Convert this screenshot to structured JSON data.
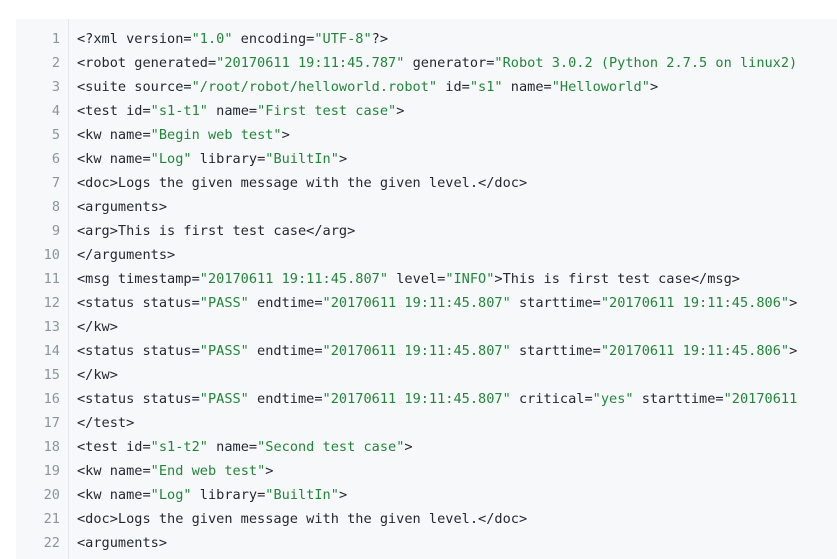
{
  "lines": [
    [
      {
        "t": "tag",
        "v": "<?xml version="
      },
      {
        "t": "str",
        "v": "\"1.0\""
      },
      {
        "t": "tag",
        "v": " encoding="
      },
      {
        "t": "str",
        "v": "\"UTF-8\""
      },
      {
        "t": "tag",
        "v": "?>"
      }
    ],
    [
      {
        "t": "tag",
        "v": "<robot generated="
      },
      {
        "t": "str",
        "v": "\"20170611 19:11:45.787\""
      },
      {
        "t": "tag",
        "v": " generator="
      },
      {
        "t": "str",
        "v": "\"Robot 3.0.2 (Python 2.7.5 on linux2)"
      }
    ],
    [
      {
        "t": "tag",
        "v": "<suite source="
      },
      {
        "t": "str",
        "v": "\"/root/robot/helloworld.robot\""
      },
      {
        "t": "tag",
        "v": " id="
      },
      {
        "t": "str",
        "v": "\"s1\""
      },
      {
        "t": "tag",
        "v": " name="
      },
      {
        "t": "str",
        "v": "\"Helloworld\""
      },
      {
        "t": "tag",
        "v": ">"
      }
    ],
    [
      {
        "t": "tag",
        "v": "<test id="
      },
      {
        "t": "str",
        "v": "\"s1-t1\""
      },
      {
        "t": "tag",
        "v": " name="
      },
      {
        "t": "str",
        "v": "\"First test case\""
      },
      {
        "t": "tag",
        "v": ">"
      }
    ],
    [
      {
        "t": "tag",
        "v": "<kw name="
      },
      {
        "t": "str",
        "v": "\"Begin web test\""
      },
      {
        "t": "tag",
        "v": ">"
      }
    ],
    [
      {
        "t": "tag",
        "v": "<kw name="
      },
      {
        "t": "str",
        "v": "\"Log\""
      },
      {
        "t": "tag",
        "v": " library="
      },
      {
        "t": "str",
        "v": "\"BuiltIn\""
      },
      {
        "t": "tag",
        "v": ">"
      }
    ],
    [
      {
        "t": "tag",
        "v": "<doc>"
      },
      {
        "t": "txt",
        "v": "Logs the given message with the given level."
      },
      {
        "t": "tag",
        "v": "</doc>"
      }
    ],
    [
      {
        "t": "tag",
        "v": "<arguments>"
      }
    ],
    [
      {
        "t": "tag",
        "v": "<arg>"
      },
      {
        "t": "txt",
        "v": "This is first test case"
      },
      {
        "t": "tag",
        "v": "</arg>"
      }
    ],
    [
      {
        "t": "tag",
        "v": "</arguments>"
      }
    ],
    [
      {
        "t": "tag",
        "v": "<msg timestamp="
      },
      {
        "t": "str",
        "v": "\"20170611 19:11:45.807\""
      },
      {
        "t": "tag",
        "v": " level="
      },
      {
        "t": "str",
        "v": "\"INFO\""
      },
      {
        "t": "tag",
        "v": ">"
      },
      {
        "t": "txt",
        "v": "This is first test case"
      },
      {
        "t": "tag",
        "v": "</msg>"
      }
    ],
    [
      {
        "t": "tag",
        "v": "<status status="
      },
      {
        "t": "str",
        "v": "\"PASS\""
      },
      {
        "t": "tag",
        "v": " endtime="
      },
      {
        "t": "str",
        "v": "\"20170611 19:11:45.807\""
      },
      {
        "t": "tag",
        "v": " starttime="
      },
      {
        "t": "str",
        "v": "\"20170611 19:11:45.806\""
      },
      {
        "t": "tag",
        "v": ">"
      }
    ],
    [
      {
        "t": "tag",
        "v": "</kw>"
      }
    ],
    [
      {
        "t": "tag",
        "v": "<status status="
      },
      {
        "t": "str",
        "v": "\"PASS\""
      },
      {
        "t": "tag",
        "v": " endtime="
      },
      {
        "t": "str",
        "v": "\"20170611 19:11:45.807\""
      },
      {
        "t": "tag",
        "v": " starttime="
      },
      {
        "t": "str",
        "v": "\"20170611 19:11:45.806\""
      },
      {
        "t": "tag",
        "v": ">"
      }
    ],
    [
      {
        "t": "tag",
        "v": "</kw>"
      }
    ],
    [
      {
        "t": "tag",
        "v": "<status status="
      },
      {
        "t": "str",
        "v": "\"PASS\""
      },
      {
        "t": "tag",
        "v": " endtime="
      },
      {
        "t": "str",
        "v": "\"20170611 19:11:45.807\""
      },
      {
        "t": "tag",
        "v": " critical="
      },
      {
        "t": "str",
        "v": "\"yes\""
      },
      {
        "t": "tag",
        "v": " starttime="
      },
      {
        "t": "str",
        "v": "\"20170611"
      }
    ],
    [
      {
        "t": "tag",
        "v": "</test>"
      }
    ],
    [
      {
        "t": "tag",
        "v": "<test id="
      },
      {
        "t": "str",
        "v": "\"s1-t2\""
      },
      {
        "t": "tag",
        "v": " name="
      },
      {
        "t": "str",
        "v": "\"Second test case\""
      },
      {
        "t": "tag",
        "v": ">"
      }
    ],
    [
      {
        "t": "tag",
        "v": "<kw name="
      },
      {
        "t": "str",
        "v": "\"End web test\""
      },
      {
        "t": "tag",
        "v": ">"
      }
    ],
    [
      {
        "t": "tag",
        "v": "<kw name="
      },
      {
        "t": "str",
        "v": "\"Log\""
      },
      {
        "t": "tag",
        "v": " library="
      },
      {
        "t": "str",
        "v": "\"BuiltIn\""
      },
      {
        "t": "tag",
        "v": ">"
      }
    ],
    [
      {
        "t": "tag",
        "v": "<doc>"
      },
      {
        "t": "txt",
        "v": "Logs the given message with the given level."
      },
      {
        "t": "tag",
        "v": "</doc>"
      }
    ],
    [
      {
        "t": "tag",
        "v": "<arguments>"
      }
    ]
  ],
  "line_numbers": [
    "1",
    "2",
    "3",
    "4",
    "5",
    "6",
    "7",
    "8",
    "9",
    "10",
    "11",
    "12",
    "13",
    "14",
    "15",
    "16",
    "17",
    "18",
    "19",
    "20",
    "21",
    "22"
  ],
  "colors": {
    "string": "#22863a",
    "text": "#24292f",
    "line_number": "#8c959f",
    "background": "#f6f8fa"
  }
}
